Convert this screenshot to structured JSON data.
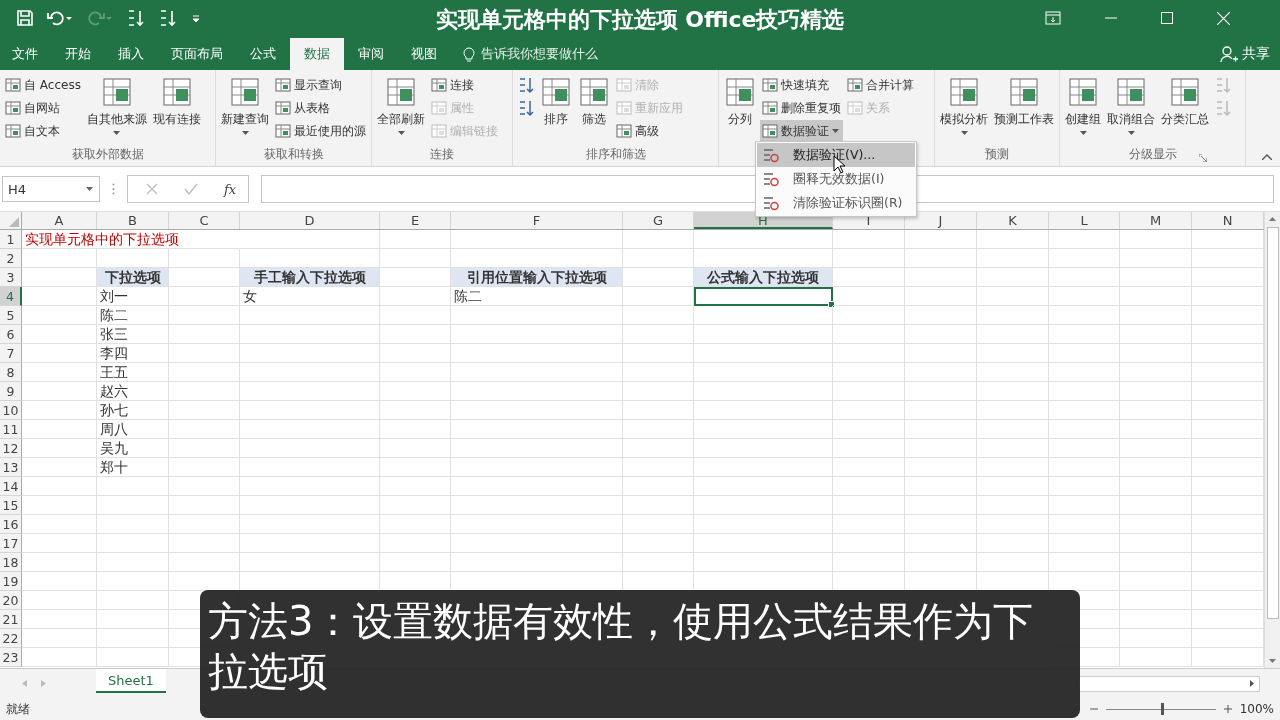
{
  "window": {
    "title": "实现单元格中的下拉选项  Office技巧精选"
  },
  "tabs": [
    {
      "label": "文件",
      "selected": false
    },
    {
      "label": "开始",
      "selected": false
    },
    {
      "label": "插入",
      "selected": false
    },
    {
      "label": "页面布局",
      "selected": false
    },
    {
      "label": "公式",
      "selected": false
    },
    {
      "label": "数据",
      "selected": true
    },
    {
      "label": "审阅",
      "selected": false
    },
    {
      "label": "视图",
      "selected": false
    }
  ],
  "tell_me": {
    "placeholder": "告诉我你想要做什么"
  },
  "share": {
    "label": "共享"
  },
  "ribbon": {
    "groups": [
      {
        "label": "获取外部数据",
        "columns": [
          {
            "kind": "small",
            "items": [
              {
                "label": "自 Access",
                "dropdown": false,
                "disabled": false,
                "expanded": false
              },
              {
                "label": "自网站",
                "dropdown": false,
                "disabled": false,
                "expanded": false
              },
              {
                "label": "自文本",
                "dropdown": false,
                "disabled": false,
                "expanded": false
              }
            ]
          },
          {
            "kind": "large",
            "items": [
              {
                "label": "自其他来源",
                "dropdown": true,
                "disabled": false,
                "expanded": false
              }
            ]
          },
          {
            "kind": "large",
            "items": [
              {
                "label": "现有连接",
                "dropdown": false,
                "disabled": false,
                "expanded": false
              }
            ]
          }
        ]
      },
      {
        "label": "获取和转换",
        "columns": [
          {
            "kind": "large",
            "items": [
              {
                "label": "新建查询",
                "dropdown": true,
                "disabled": false,
                "expanded": false
              }
            ]
          },
          {
            "kind": "small",
            "items": [
              {
                "label": "显示查询",
                "dropdown": false,
                "disabled": false,
                "expanded": false
              },
              {
                "label": "从表格",
                "dropdown": false,
                "disabled": false,
                "expanded": false
              },
              {
                "label": "最近使用的源",
                "dropdown": false,
                "disabled": false,
                "expanded": false
              }
            ]
          }
        ]
      },
      {
        "label": "连接",
        "columns": [
          {
            "kind": "large",
            "items": [
              {
                "label": "全部刷新",
                "dropdown": true,
                "disabled": false,
                "expanded": false
              }
            ]
          },
          {
            "kind": "small",
            "items": [
              {
                "label": "连接",
                "dropdown": false,
                "disabled": false,
                "expanded": false
              },
              {
                "label": "属性",
                "dropdown": false,
                "disabled": true,
                "expanded": false
              },
              {
                "label": "编辑链接",
                "dropdown": false,
                "disabled": true,
                "expanded": false
              }
            ]
          }
        ]
      },
      {
        "label": "排序和筛选",
        "columns": [
          {
            "kind": "small",
            "items": [
              {
                "dropdown": false,
                "disabled": false,
                "expanded": false
              },
              {
                "dropdown": false,
                "disabled": false,
                "expanded": false
              }
            ]
          },
          {
            "kind": "large",
            "items": [
              {
                "label": "排序",
                "dropdown": false,
                "disabled": false,
                "expanded": false
              }
            ]
          },
          {
            "kind": "large",
            "items": [
              {
                "label": "筛选",
                "dropdown": false,
                "disabled": false,
                "expanded": false
              }
            ]
          },
          {
            "kind": "small",
            "items": [
              {
                "label": "清除",
                "dropdown": false,
                "disabled": true,
                "expanded": false
              },
              {
                "label": "重新应用",
                "dropdown": false,
                "disabled": true,
                "expanded": false
              },
              {
                "label": "高级",
                "dropdown": false,
                "disabled": false,
                "expanded": false
              }
            ]
          }
        ]
      },
      {
        "columns": [
          {
            "kind": "large",
            "items": [
              {
                "label": "分列",
                "dropdown": false,
                "disabled": false,
                "expanded": false
              }
            ]
          },
          {
            "kind": "small",
            "items": [
              {
                "label": "快速填充",
                "dropdown": false,
                "disabled": false,
                "expanded": false
              },
              {
                "label": "删除重复项",
                "dropdown": false,
                "disabled": false,
                "expanded": false
              },
              {
                "label": "数据验证",
                "dropdown": true,
                "disabled": false,
                "expanded": true
              }
            ]
          },
          {
            "kind": "small",
            "items": [
              {
                "label": "合并计算",
                "dropdown": false,
                "disabled": false,
                "expanded": false
              },
              {
                "label": "关系",
                "dropdown": false,
                "disabled": true,
                "expanded": false
              }
            ]
          }
        ]
      },
      {
        "label": "预测",
        "columns": [
          {
            "kind": "large",
            "items": [
              {
                "label": "模拟分析",
                "dropdown": true,
                "disabled": false,
                "expanded": false
              }
            ]
          },
          {
            "kind": "large",
            "items": [
              {
                "label": "预测工作表",
                "dropdown": false,
                "disabled": false,
                "expanded": false
              }
            ]
          }
        ]
      },
      {
        "label": "分级显示",
        "columns": [
          {
            "kind": "large",
            "items": [
              {
                "label": "创建组",
                "dropdown": true,
                "disabled": false,
                "expanded": false
              }
            ]
          },
          {
            "kind": "large",
            "items": [
              {
                "label": "取消组合",
                "dropdown": true,
                "disabled": false,
                "expanded": false
              }
            ]
          },
          {
            "kind": "large",
            "items": [
              {
                "label": "分类汇总",
                "dropdown": false,
                "disabled": false,
                "expanded": false
              }
            ]
          },
          {
            "kind": "small",
            "items": [
              {
                "dropdown": false,
                "disabled": true,
                "expanded": false
              },
              {
                "dropdown": false,
                "disabled": true,
                "expanded": false
              }
            ]
          }
        ]
      }
    ]
  },
  "validation_menu": {
    "items": [
      {
        "label": "数据验证(V)...",
        "selected": true
      },
      {
        "label": "圈释无效数据(I)",
        "selected": false
      },
      {
        "label": "清除验证标识圈(R)",
        "selected": false
      }
    ]
  },
  "formula_bar": {
    "name_box": "H4",
    "function_label": "fx"
  },
  "sheet": {
    "columns": [
      {
        "label": "A",
        "selected": false
      },
      {
        "label": "B",
        "selected": false
      },
      {
        "label": "C",
        "selected": false
      },
      {
        "label": "D",
        "selected": false
      },
      {
        "label": "E",
        "selected": false
      },
      {
        "label": "F",
        "selected": false
      },
      {
        "label": "G",
        "selected": false
      },
      {
        "label": "H",
        "selected": true
      },
      {
        "label": "I",
        "selected": false
      },
      {
        "label": "J",
        "selected": false
      },
      {
        "label": "K",
        "selected": false
      },
      {
        "label": "L",
        "selected": false
      },
      {
        "label": "M",
        "selected": false
      },
      {
        "label": "N",
        "selected": false
      }
    ],
    "rows": [
      {
        "label": "1",
        "selected": false,
        "cells": [
          {
            "kind": "title",
            "text": "实现单元格中的下拉选项"
          }
        ]
      },
      {
        "label": "2",
        "selected": false
      },
      {
        "label": "3",
        "selected": false,
        "cells": [
          {
            "kind": "empty"
          },
          {
            "kind": "header",
            "text": "下拉选项"
          },
          {
            "kind": "empty"
          },
          {
            "kind": "header",
            "text": "手工输入下拉选项"
          },
          {
            "kind": "empty"
          },
          {
            "kind": "header",
            "text": "引用位置输入下拉选项"
          },
          {
            "kind": "empty"
          },
          {
            "kind": "header",
            "text": "公式输入下拉选项"
          }
        ]
      },
      {
        "label": "4",
        "selected": true,
        "cells": [
          {
            "kind": "empty"
          },
          {
            "kind": "value",
            "text": "刘一"
          },
          {
            "kind": "empty"
          },
          {
            "kind": "value",
            "text": "女"
          },
          {
            "kind": "empty"
          },
          {
            "kind": "value",
            "text": "陈二"
          }
        ]
      },
      {
        "label": "5",
        "selected": false,
        "cells": [
          {
            "kind": "empty"
          },
          {
            "kind": "value",
            "text": "陈二"
          }
        ]
      },
      {
        "label": "6",
        "selected": false,
        "cells": [
          {
            "kind": "empty"
          },
          {
            "kind": "value",
            "text": "张三"
          }
        ]
      },
      {
        "label": "7",
        "selected": false,
        "cells": [
          {
            "kind": "empty"
          },
          {
            "kind": "value",
            "text": "李四"
          }
        ]
      },
      {
        "label": "8",
        "selected": false,
        "cells": [
          {
            "kind": "empty"
          },
          {
            "kind": "value",
            "text": "王五"
          }
        ]
      },
      {
        "label": "9",
        "selected": false,
        "cells": [
          {
            "kind": "empty"
          },
          {
            "kind": "value",
            "text": "赵六"
          }
        ]
      },
      {
        "label": "10",
        "selected": false,
        "cells": [
          {
            "kind": "empty"
          },
          {
            "kind": "value",
            "text": "孙七"
          }
        ]
      },
      {
        "label": "11",
        "selected": false,
        "cells": [
          {
            "kind": "empty"
          },
          {
            "kind": "value",
            "text": "周八"
          }
        ]
      },
      {
        "label": "12",
        "selected": false,
        "cells": [
          {
            "kind": "empty"
          },
          {
            "kind": "value",
            "text": "吴九"
          }
        ]
      },
      {
        "label": "13",
        "selected": false,
        "cells": [
          {
            "kind": "empty"
          },
          {
            "kind": "value",
            "text": "郑十"
          }
        ]
      },
      {
        "label": "14",
        "selected": false
      },
      {
        "label": "15",
        "selected": false
      },
      {
        "label": "16",
        "selected": false
      },
      {
        "label": "17",
        "selected": false
      },
      {
        "label": "18",
        "selected": false
      },
      {
        "label": "19",
        "selected": false
      },
      {
        "label": "20",
        "selected": false
      },
      {
        "label": "21",
        "selected": false
      },
      {
        "label": "22",
        "selected": false
      },
      {
        "label": "23",
        "selected": false
      }
    ]
  },
  "sheet_tabs": [
    {
      "label": "Sheet1",
      "selected": true
    }
  ],
  "status_bar": {
    "status": "就绪",
    "zoom": {
      "level": 0.5,
      "reading": "100%"
    }
  },
  "caption": {
    "text": "方法3：设置数据有效性，使用公式结果作为下拉选项"
  }
}
